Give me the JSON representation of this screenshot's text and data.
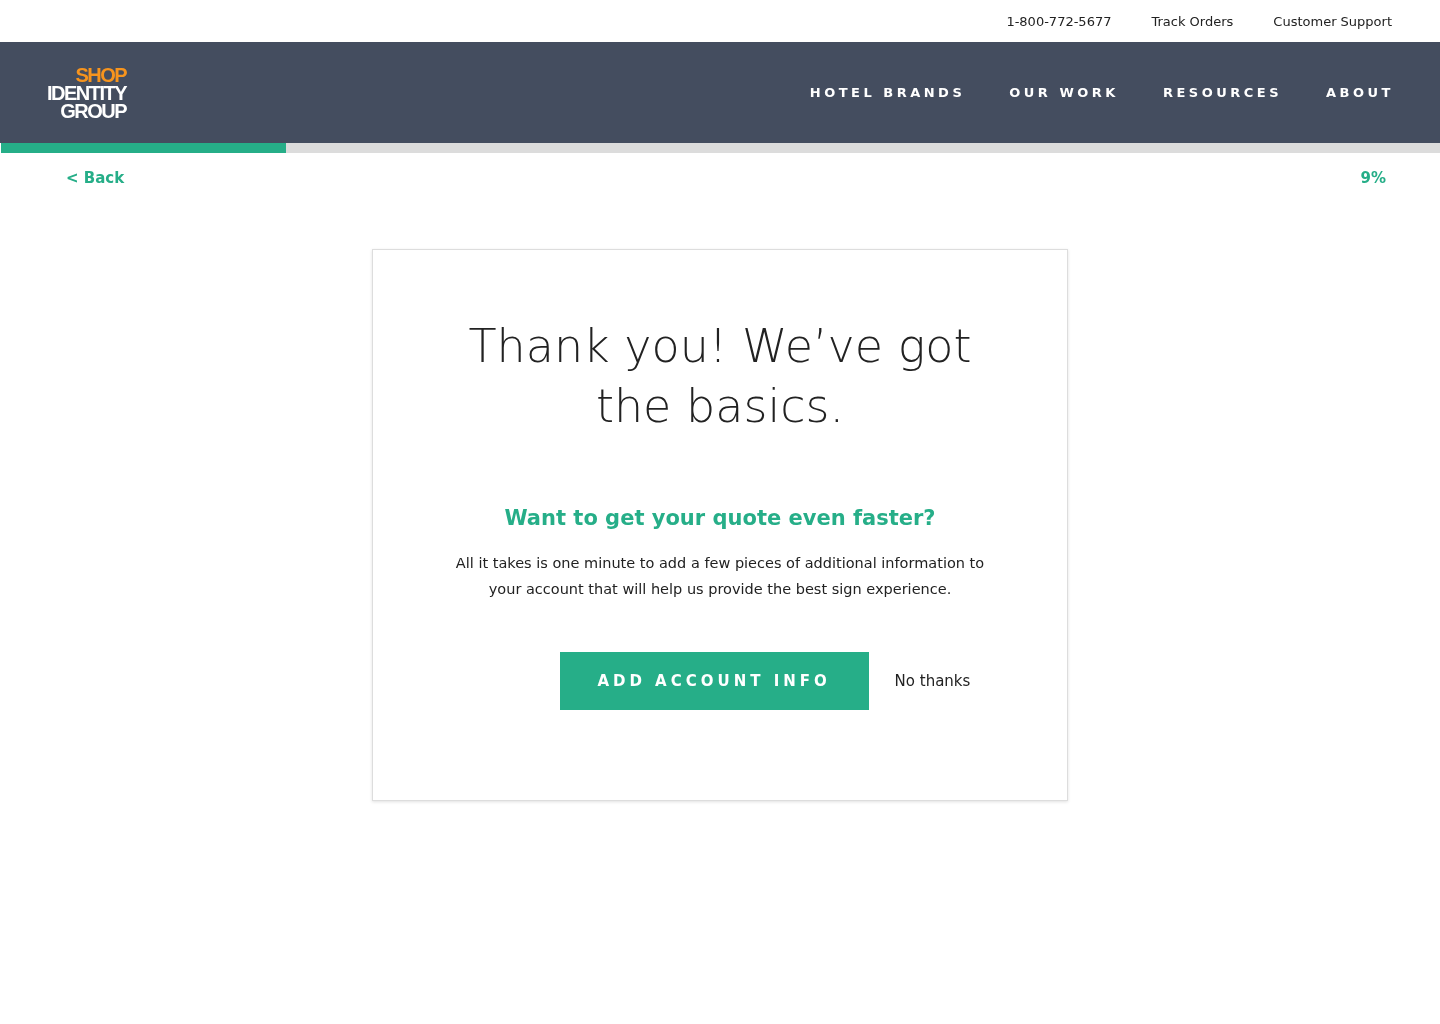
{
  "utility_links": [
    "1-800-772-5677",
    "Track Orders",
    "Customer Support"
  ],
  "logo": {
    "lines": [
      "SHOP",
      "IDENTITY",
      "GROUP"
    ]
  },
  "nav": [
    "HOTEL BRANDS",
    "OUR WORK",
    "RESOURCES",
    "ABOUT"
  ],
  "progress": {
    "level": 0.198,
    "back": "< Back",
    "percent": "9%"
  },
  "card": {
    "title": "Thank you! We’ve got the basics.",
    "subtitle": "Want to get your quote even faster?",
    "body": "All it takes is one minute to add a few pieces of additional information to your account that will help us provide the best sign experience.",
    "primary_button": "ADD ACCOUNT INFO",
    "secondary_link": "No thanks"
  }
}
